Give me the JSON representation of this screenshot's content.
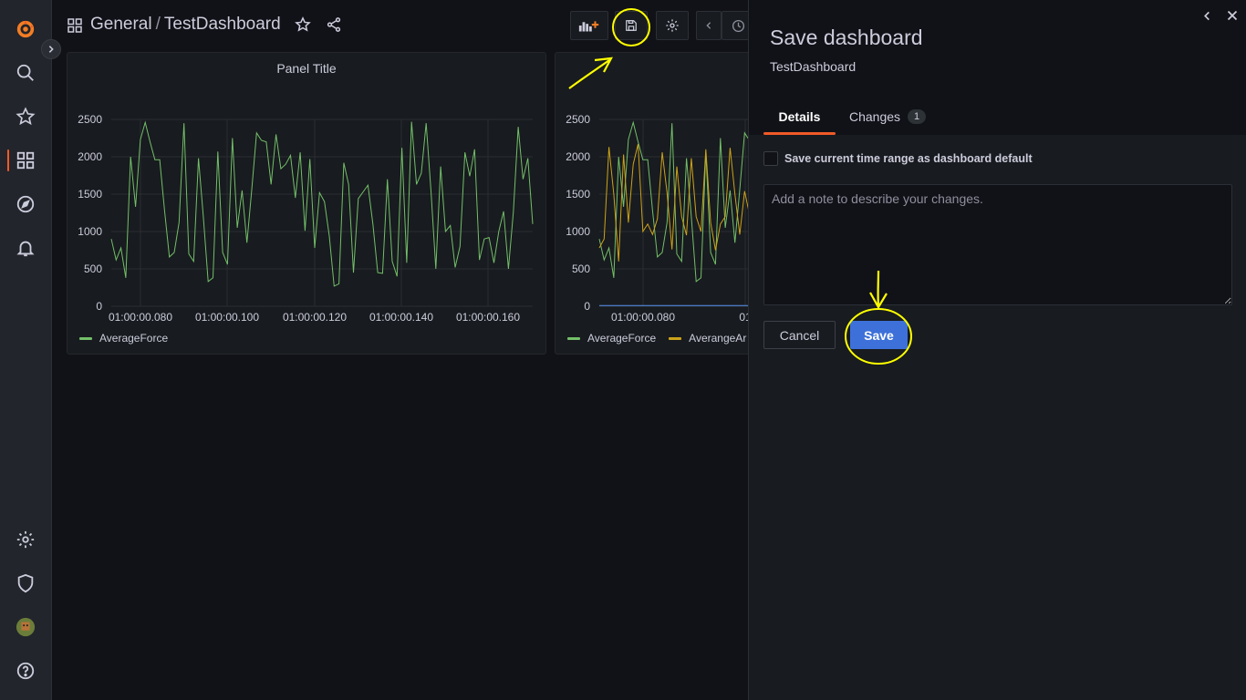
{
  "breadcrumb": {
    "folder": "General",
    "separator": "/",
    "dashboard": "TestDashboard"
  },
  "panels": [
    {
      "title": "Panel Title",
      "legend": [
        "AverageForce"
      ]
    },
    {
      "title": "",
      "legend": [
        "AverageForce",
        "AverangeAr"
      ]
    }
  ],
  "drawer": {
    "title": "Save dashboard",
    "subtitle": "TestDashboard",
    "tabs": [
      {
        "label": "Details"
      },
      {
        "label": "Changes",
        "count": "1"
      }
    ],
    "checkbox_label": "Save current time range as dashboard default",
    "note_placeholder": "Add a note to describe your changes.",
    "cancel_label": "Cancel",
    "save_label": "Save"
  },
  "colors": {
    "accent": "#f05a28",
    "primary": "#3d71d9",
    "series_green": "#73bf69",
    "series_yellow": "#cca31a",
    "series_blue": "#5794f2",
    "annotation": "#ffff00"
  },
  "chart_data": [
    {
      "type": "line",
      "title": "Panel Title",
      "ylim": [
        0,
        2500
      ],
      "yticks": [
        "0",
        "500",
        "1000",
        "1500",
        "2000",
        "2500"
      ],
      "xticks": [
        "01:00:00.080",
        "01:00:00.100",
        "01:00:00.120",
        "01:00:00.140",
        "01:00:00.160"
      ],
      "series": [
        {
          "name": "AverageForce",
          "color": "#73bf69",
          "values": [
            900,
            620,
            780,
            380,
            2000,
            1330,
            2230,
            2460,
            2200,
            1960,
            1960,
            1280,
            660,
            720,
            1120,
            2450,
            700,
            600,
            1980,
            1200,
            330,
            380,
            2070,
            720,
            560,
            2250,
            1050,
            1550,
            850,
            1560,
            2320,
            2220,
            2200,
            1630,
            2300,
            1840,
            1900,
            2020,
            1450,
            2060,
            1010,
            1970,
            780,
            1520,
            1400,
            940,
            270,
            300,
            1920,
            1630,
            450,
            1440,
            1530,
            1620,
            1100,
            450,
            440,
            1700,
            600,
            400,
            2120,
            580,
            2470,
            1630,
            1780,
            2450,
            1540,
            500,
            1870,
            1000,
            1080,
            520,
            800,
            2060,
            1740,
            2100,
            620,
            900,
            920,
            580,
            1000,
            1270,
            500,
            1260,
            2400,
            1700,
            1980,
            1100
          ]
        }
      ]
    },
    {
      "type": "line",
      "ylim": [
        0,
        2500
      ],
      "yticks": [
        "0",
        "500",
        "1000",
        "1500",
        "2000",
        "2500"
      ],
      "xticks": [
        "01:00:00.080",
        "01"
      ],
      "series": [
        {
          "name": "AverageForce",
          "color": "#73bf69",
          "values": [
            900,
            620,
            780,
            380,
            2000,
            1330,
            2230,
            2460,
            2200,
            1960,
            1960,
            1280,
            660,
            720,
            1120,
            2450,
            700,
            600,
            1980,
            1200,
            330,
            380,
            2070,
            720,
            560,
            2250,
            1050,
            1550,
            850,
            1560,
            2320,
            2220
          ]
        },
        {
          "name": "AverangeAr",
          "color": "#cca31a",
          "values": [
            780,
            900,
            2130,
            1500,
            600,
            2030,
            1120,
            1900,
            2170,
            1000,
            1100,
            960,
            1170,
            2060,
            1520,
            760,
            1870,
            1200,
            950,
            1980,
            1200,
            1000,
            2100,
            1120,
            750,
            1100,
            1200,
            2120,
            1500,
            960,
            1540,
            1230
          ]
        },
        {
          "name": "",
          "color": "#5794f2",
          "values": [
            10,
            10,
            10,
            10,
            10,
            10,
            10,
            10,
            10,
            10,
            10,
            10,
            10,
            10,
            10,
            10,
            10,
            10,
            10,
            10,
            10,
            10,
            10,
            10,
            10,
            10,
            10,
            10,
            10,
            10,
            10,
            10
          ]
        }
      ]
    }
  ]
}
